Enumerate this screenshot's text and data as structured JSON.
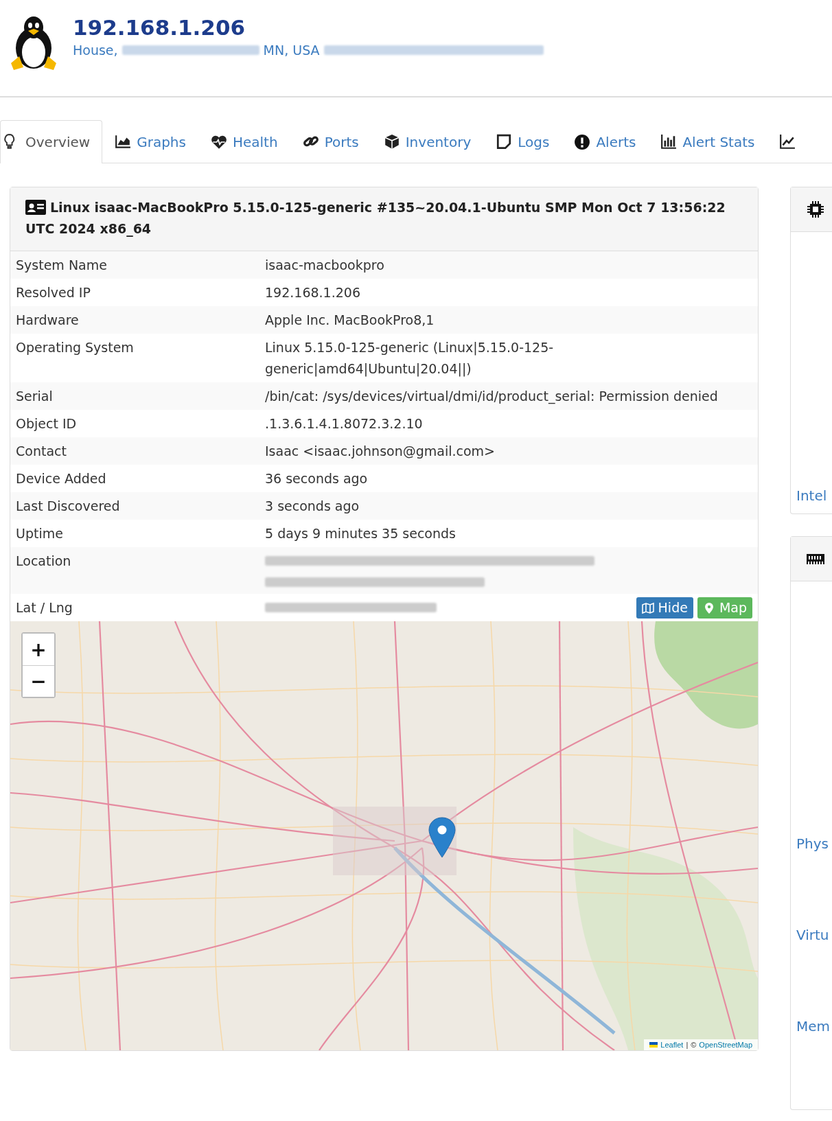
{
  "header": {
    "title": "192.168.1.206",
    "subtitle": [
      {
        "kind": "text",
        "text": "House,"
      },
      {
        "kind": "redacted"
      },
      {
        "kind": "text",
        "text": "MN, USA"
      },
      {
        "kind": "redacted"
      }
    ]
  },
  "tabs": [
    {
      "label": "Overview",
      "selected": true
    },
    {
      "label": "Graphs",
      "selected": false
    },
    {
      "label": "Health",
      "selected": false
    },
    {
      "label": "Ports",
      "selected": false
    },
    {
      "label": "Inventory",
      "selected": false
    },
    {
      "label": "Logs",
      "selected": false
    },
    {
      "label": "Alerts",
      "selected": false
    },
    {
      "label": "Alert Stats",
      "selected": false
    },
    {
      "selected": false
    }
  ],
  "overview": {
    "title": "Linux isaac-MacBookPro 5.15.0-125-generic #135~20.04.1-Ubuntu SMP Mon Oct 7 13:56:22 UTC 2024 x86_64",
    "rows": [
      {
        "label": "System Name",
        "kind": "text",
        "value": "isaac-macbookpro"
      },
      {
        "label": "Resolved IP",
        "kind": "text",
        "value": "192.168.1.206"
      },
      {
        "label": "Hardware",
        "kind": "text",
        "value": "Apple Inc. MacBookPro8,1"
      },
      {
        "label": "Operating System",
        "kind": "text",
        "value": "Linux 5.15.0-125-generic (Linux|5.15.0-125-generic|amd64|Ubuntu|20.04||)"
      },
      {
        "label": "Serial",
        "kind": "text",
        "value": "/bin/cat: /sys/devices/virtual/dmi/id/product_serial: Permission denied"
      },
      {
        "label": "Object ID",
        "kind": "text",
        "value": ".1.3.6.1.4.1.8072.3.2.10"
      },
      {
        "label": "Contact",
        "kind": "text",
        "value": "Isaac <isaac.johnson@gmail.com>"
      },
      {
        "label": "Device Added",
        "kind": "text",
        "value": "36 seconds ago"
      },
      {
        "label": "Last Discovered",
        "kind": "text",
        "value": "3 seconds ago"
      },
      {
        "label": "Uptime",
        "kind": "text",
        "value": "5 days 9 minutes 35 seconds"
      },
      {
        "label": "Location",
        "kind": "redacted-address"
      },
      {
        "label": "Lat / Lng",
        "kind": "redacted-coords",
        "buttons": [
          "Hide",
          "Map"
        ]
      }
    ],
    "map": {
      "zoom_in": "+",
      "zoom_out": "−",
      "attribution": [
        {
          "kind": "link",
          "text": "Leaflet"
        },
        {
          "kind": "text",
          "text": "|"
        },
        {
          "kind": "text",
          "text": "©"
        },
        {
          "kind": "link",
          "text": "OpenStreetMap"
        }
      ]
    }
  },
  "side_panels": [
    {
      "items": [
        "Intel"
      ]
    },
    {
      "items": [
        "Phys",
        "Virtu",
        "Mem"
      ]
    }
  ]
}
